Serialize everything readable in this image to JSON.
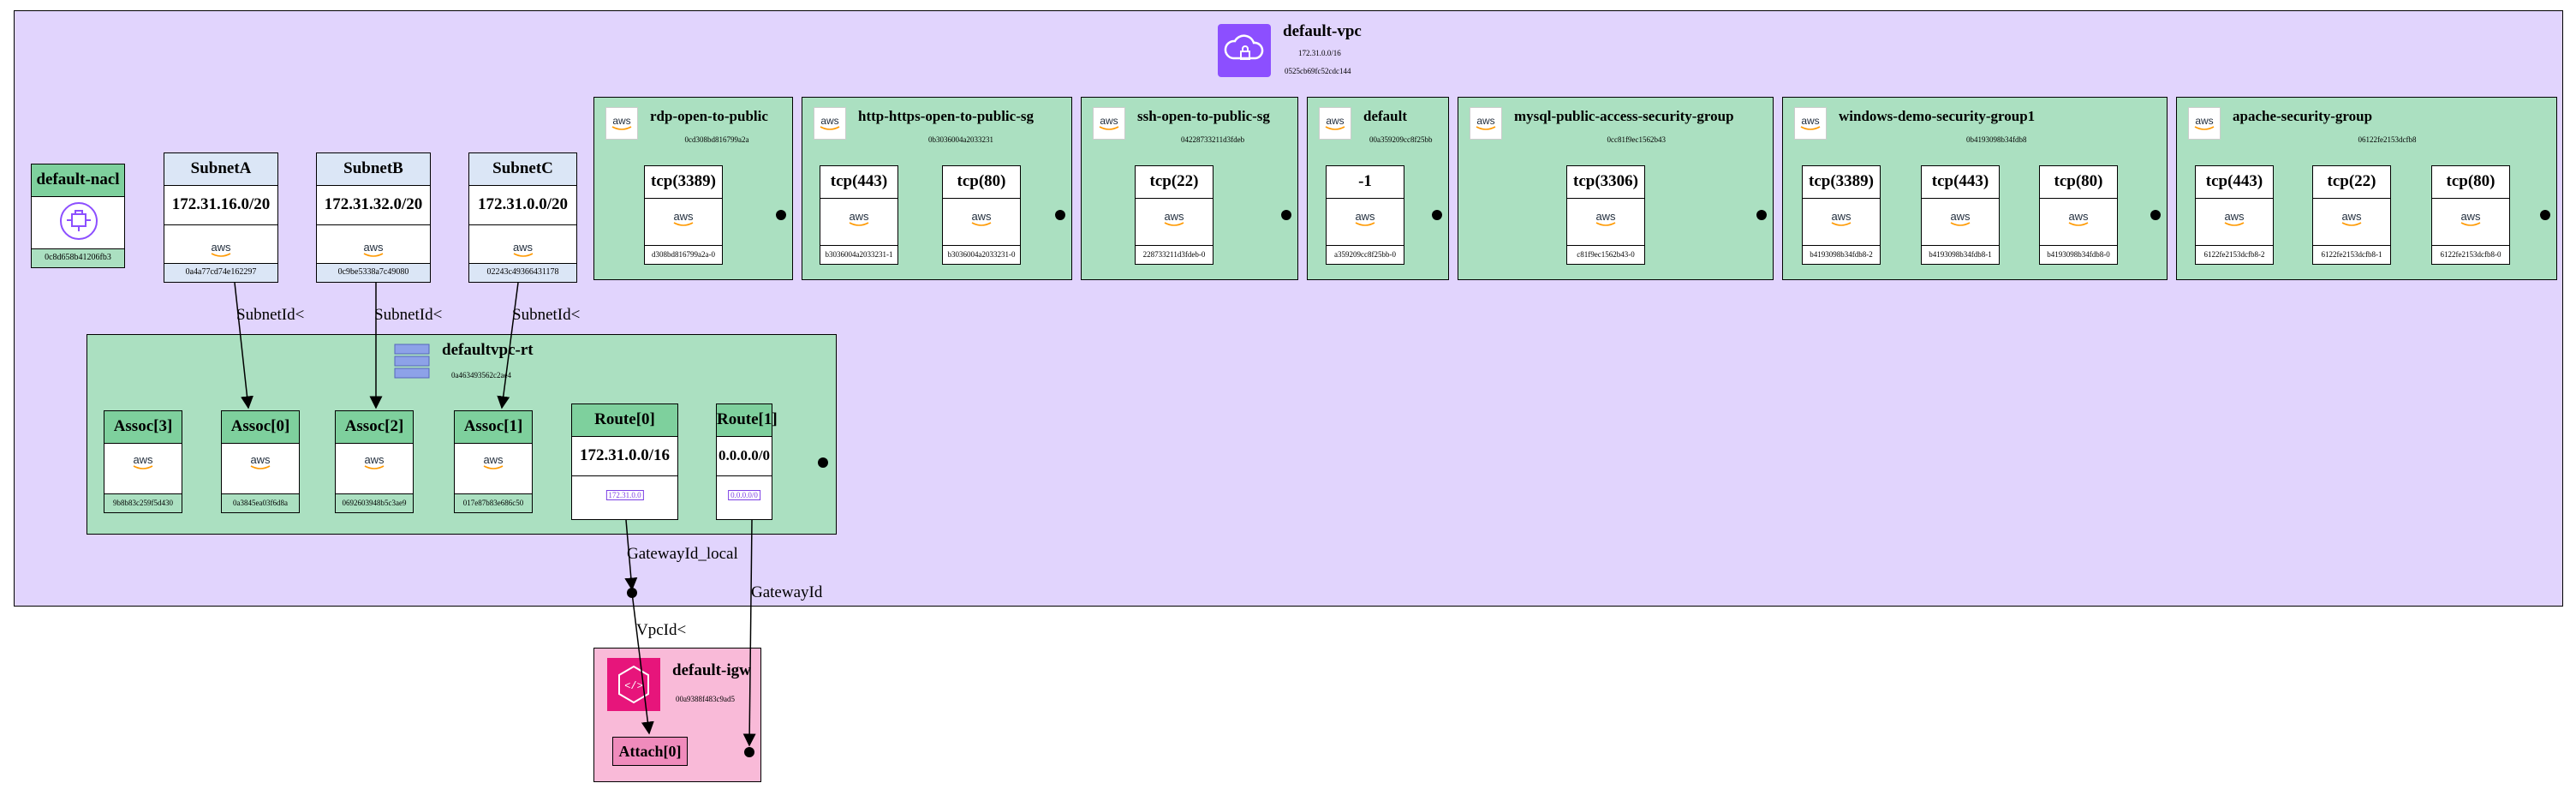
{
  "vpc": {
    "title": "default-vpc",
    "cidr": "172.31.0.0/16",
    "id": "0525cb69fc52cdc144",
    "icon": "vpc-icon",
    "color": "#e1d4fd"
  },
  "nacl": {
    "title": "default-nacl",
    "id": "0c8d658b41206fb3",
    "icon": "nacl-icon"
  },
  "subnets": [
    {
      "title": "SubnetA",
      "cidr": "172.31.16.0/20",
      "id": "0a4a77cd74e162297"
    },
    {
      "title": "SubnetB",
      "cidr": "172.31.32.0/20",
      "id": "0c9be5338a7c49080"
    },
    {
      "title": "SubnetC",
      "cidr": "172.31.0.0/20",
      "id": "02243c49366431178"
    }
  ],
  "security_groups": [
    {
      "title": "rdp-open-to-public",
      "id": "0cd308bd816799a2a",
      "rules": [
        {
          "label": "tcp(3389)",
          "id": "d308bd816799a2a-0"
        }
      ]
    },
    {
      "title": "http-https-open-to-public-sg",
      "id": "0b3036004a2033231",
      "rules": [
        {
          "label": "tcp(443)",
          "id": "b3036004a2033231-1"
        },
        {
          "label": "tcp(80)",
          "id": "b3036004a2033231-0"
        }
      ]
    },
    {
      "title": "ssh-open-to-public-sg",
      "id": "04228733211d3fdeb",
      "rules": [
        {
          "label": "tcp(22)",
          "id": "228733211d3fdeb-0"
        }
      ]
    },
    {
      "title": "default",
      "id": "00a359209cc8f25bb",
      "rules": [
        {
          "label": "-1",
          "id": "a359209cc8f25bb-0"
        }
      ]
    },
    {
      "title": "mysql-public-access-security-group",
      "id": "0cc81f9ec1562b43",
      "rules": [
        {
          "label": "tcp(3306)",
          "id": "c81f9ec1562b43-0"
        }
      ]
    },
    {
      "title": "windows-demo-security-group1",
      "id": "0b4193098b34fdb8",
      "rules": [
        {
          "label": "tcp(3389)",
          "id": "b4193098b34fdb8-2"
        },
        {
          "label": "tcp(443)",
          "id": "b4193098b34fdb8-1"
        },
        {
          "label": "tcp(80)",
          "id": "b4193098b34fdb8-0"
        }
      ]
    },
    {
      "title": "apache-security-group",
      "id": "06122fe2153dcfb8",
      "rules": [
        {
          "label": "tcp(443)",
          "id": "6122fe2153dcfb8-2"
        },
        {
          "label": "tcp(22)",
          "id": "6122fe2153dcfb8-1"
        },
        {
          "label": "tcp(80)",
          "id": "6122fe2153dcfb8-0"
        }
      ]
    }
  ],
  "route_table": {
    "title": "defaultvpc-rt",
    "id": "0a463493562c2ae4",
    "icon": "route-table-icon",
    "assocs": [
      {
        "title": "Assoc[3]",
        "id": "9b8b83c259f5d430"
      },
      {
        "title": "Assoc[0]",
        "id": "0a3845ea03f6d8a"
      },
      {
        "title": "Assoc[2]",
        "id": "0692603948b5c3ae9"
      },
      {
        "title": "Assoc[1]",
        "id": "017e87b83e686c50"
      }
    ],
    "routes": [
      {
        "title": "Route[0]",
        "cidr": "172.31.0.0/16",
        "link": "172.31.0.0"
      },
      {
        "title": "Route[1]",
        "cidr": "0.0.0.0/0",
        "link": "0.0.0.0/0"
      }
    ]
  },
  "igw": {
    "title": "default-igw",
    "id": "00a9388f483c9ad5",
    "icon": "internet-gateway-icon",
    "attach": "Attach[0]"
  },
  "edge_labels": {
    "subnet_a": "SubnetId<",
    "subnet_b": "SubnetId<",
    "subnet_c": "SubnetId<",
    "gw_local": "GatewayId_local",
    "gw": "GatewayId",
    "vpc_id": "VpcId<"
  },
  "aws_logo": "aws",
  "colors": {
    "vpc_bg": "#e1d4fd",
    "group_bg": "#abe0c1",
    "header_green": "#7ed09d",
    "subnet_header": "#dbe6f6",
    "igw_bg": "#f9bad8",
    "igw_icon": "#e7157b",
    "vpc_icon": "#8c4fff"
  }
}
